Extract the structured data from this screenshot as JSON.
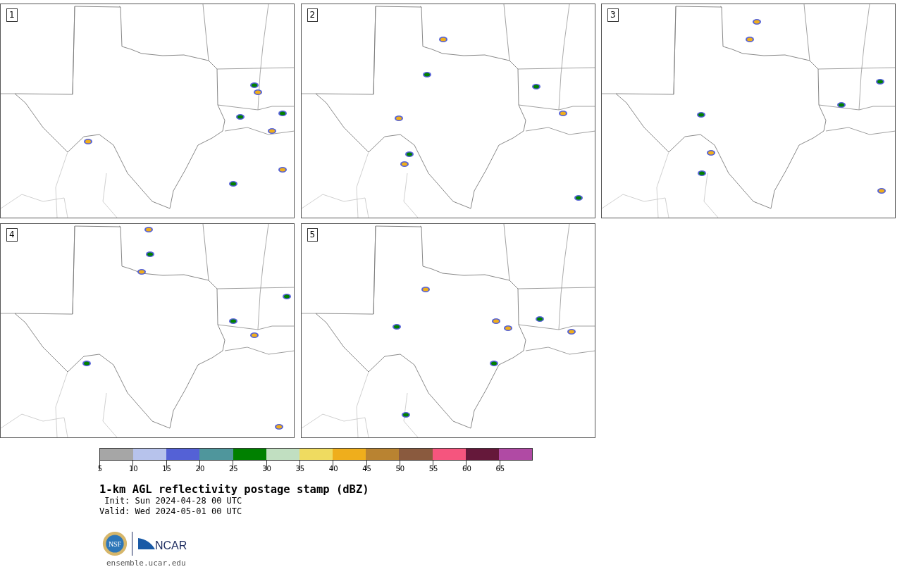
{
  "panels": [
    {
      "label": "1"
    },
    {
      "label": "2"
    },
    {
      "label": "3"
    },
    {
      "label": "4"
    },
    {
      "label": "5"
    }
  ],
  "colorbar": {
    "segments": [
      {
        "color": "#a6a6a6"
      },
      {
        "color": "#b7c3ec"
      },
      {
        "color": "#5461d6"
      },
      {
        "color": "#4f969c"
      },
      {
        "color": "#008000"
      },
      {
        "color": "#c1dfc1"
      },
      {
        "color": "#efdb60"
      },
      {
        "color": "#efae1c"
      },
      {
        "color": "#b98331"
      },
      {
        "color": "#8a5a3e"
      },
      {
        "color": "#f5557e"
      },
      {
        "color": "#65183a"
      },
      {
        "color": "#b04aa4"
      }
    ],
    "ticks": [
      "5",
      "10",
      "15",
      "20",
      "25",
      "30",
      "35",
      "40",
      "45",
      "50",
      "55",
      "60",
      "65"
    ]
  },
  "title": "1-km AGL reflectivity postage stamp (dBZ)",
  "init": " Init: Sun 2024-04-28 00 UTC",
  "valid": "Valid: Wed 2024-05-01 00 UTC",
  "logos": {
    "nsf": "NSF",
    "ncar": "NCAR"
  },
  "footer_link": "ensemble.ucar.edu"
}
